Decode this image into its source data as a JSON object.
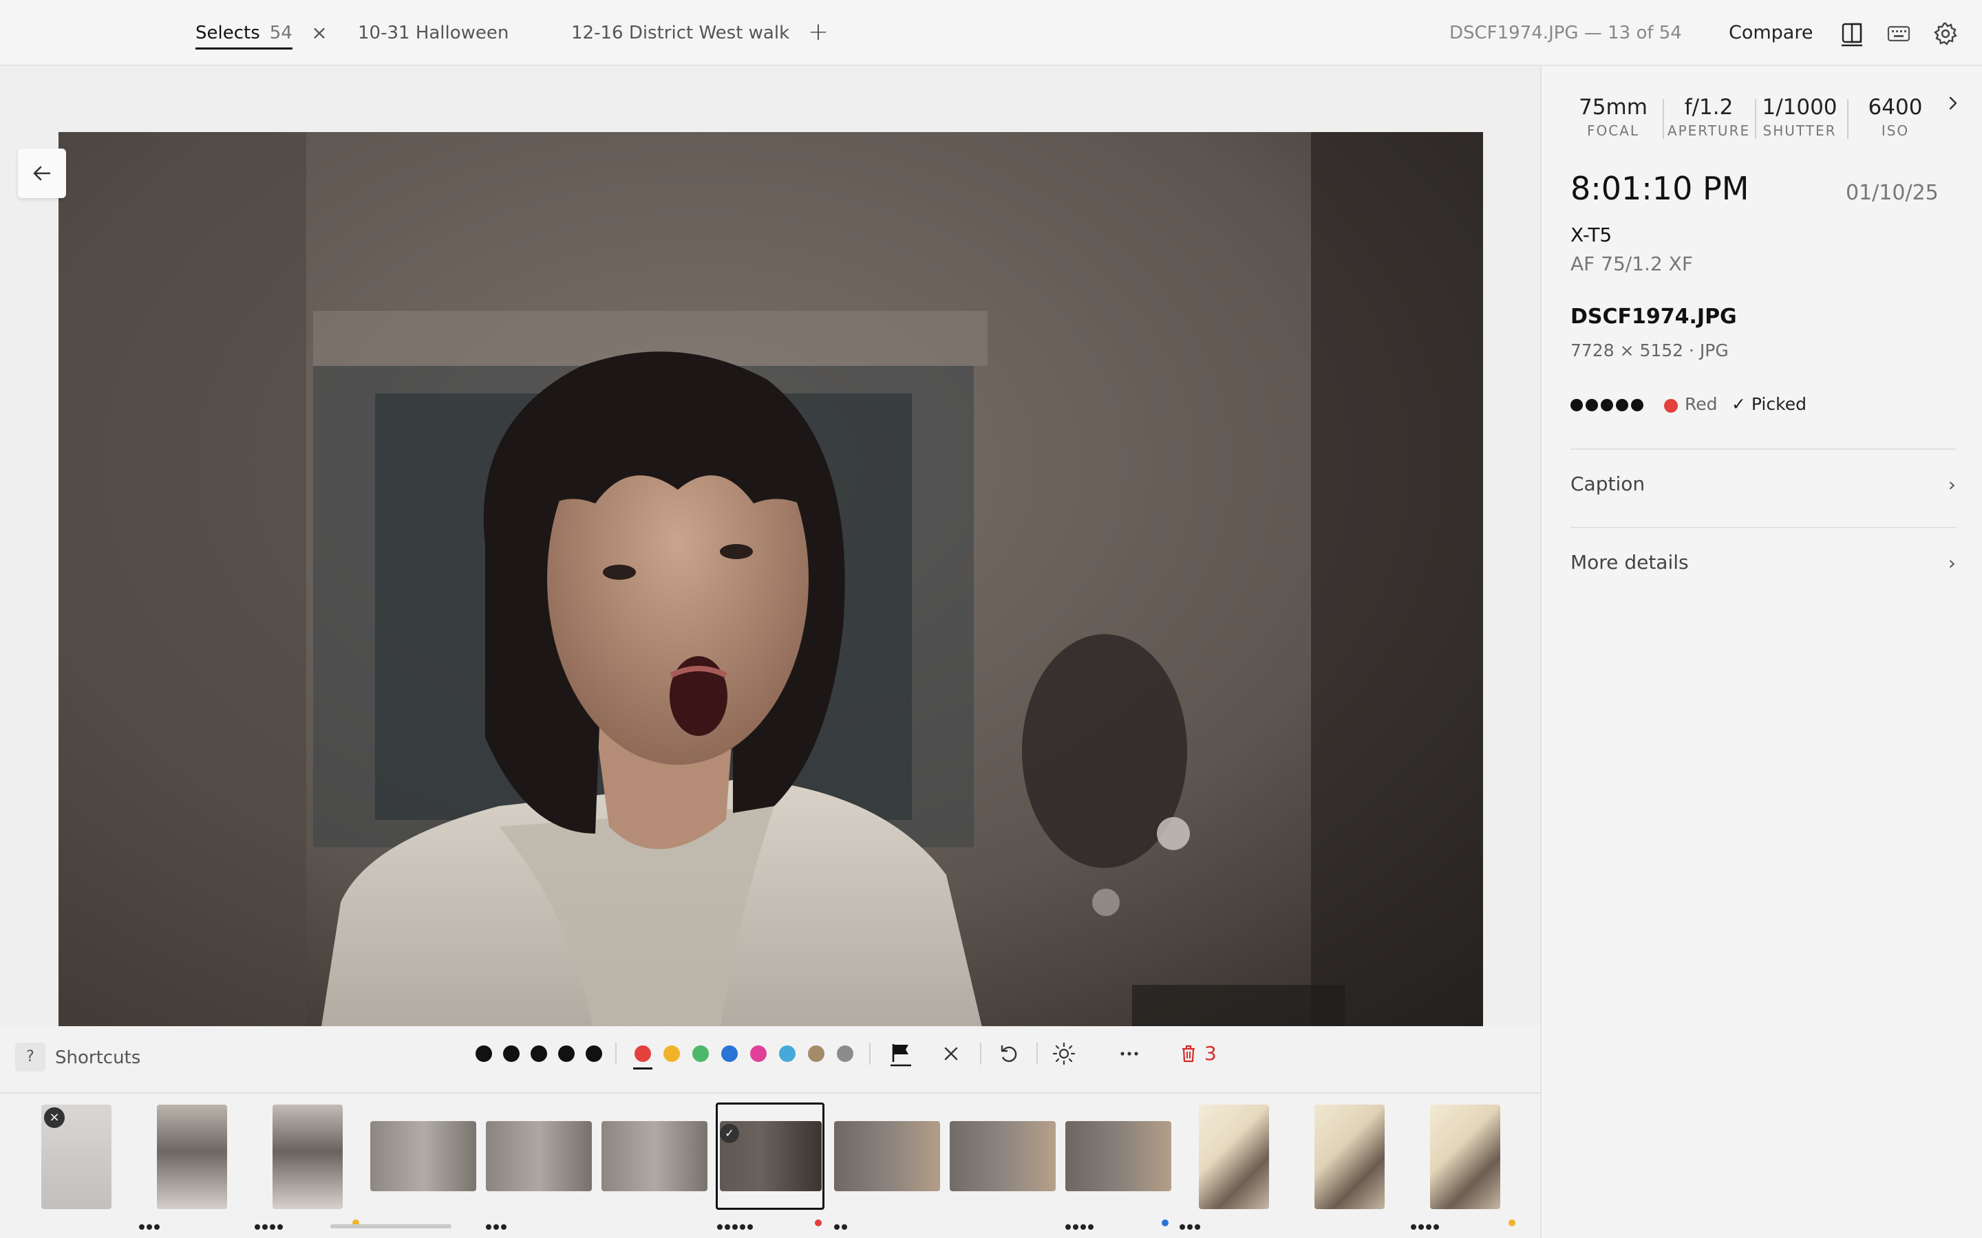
{
  "tabs": [
    {
      "label": "Selects",
      "count": "54"
    },
    {
      "label": "10-31 Halloween"
    },
    {
      "label": "12-16 District West walk"
    }
  ],
  "header": {
    "file_counter": "DSCF1974.JPG — 13 of 54",
    "compare_label": "Compare"
  },
  "toolbar": {
    "shortcut_key": "?",
    "shortcuts_label": "Shortcuts",
    "trash_count": "3",
    "color_labels": [
      "#e2413d",
      "#f2b32b",
      "#4cb86a",
      "#2a74d8",
      "#e0409a",
      "#46a9d9",
      "#a48b6a",
      "#8c8c8c"
    ]
  },
  "panel": {
    "exif": [
      {
        "value": "75mm",
        "label": "FOCAL"
      },
      {
        "value": "f/1.2",
        "label": "APERTURE"
      },
      {
        "value": "1/1000",
        "label": "SHUTTER"
      },
      {
        "value": "6400",
        "label": "ISO"
      }
    ],
    "time": "8:01:10 PM",
    "date": "01/10/25",
    "camera": "X-T5",
    "lens": "AF 75/1.2 XF",
    "filename": "DSCF1974.JPG",
    "dimensions": "7728 × 5152 · JPG",
    "rating": 5,
    "color_label": "Red",
    "color_label_hex": "#e2413d",
    "picked_label": "✓ Picked",
    "sections": [
      {
        "label": "Caption"
      },
      {
        "label": "More details"
      }
    ]
  }
}
